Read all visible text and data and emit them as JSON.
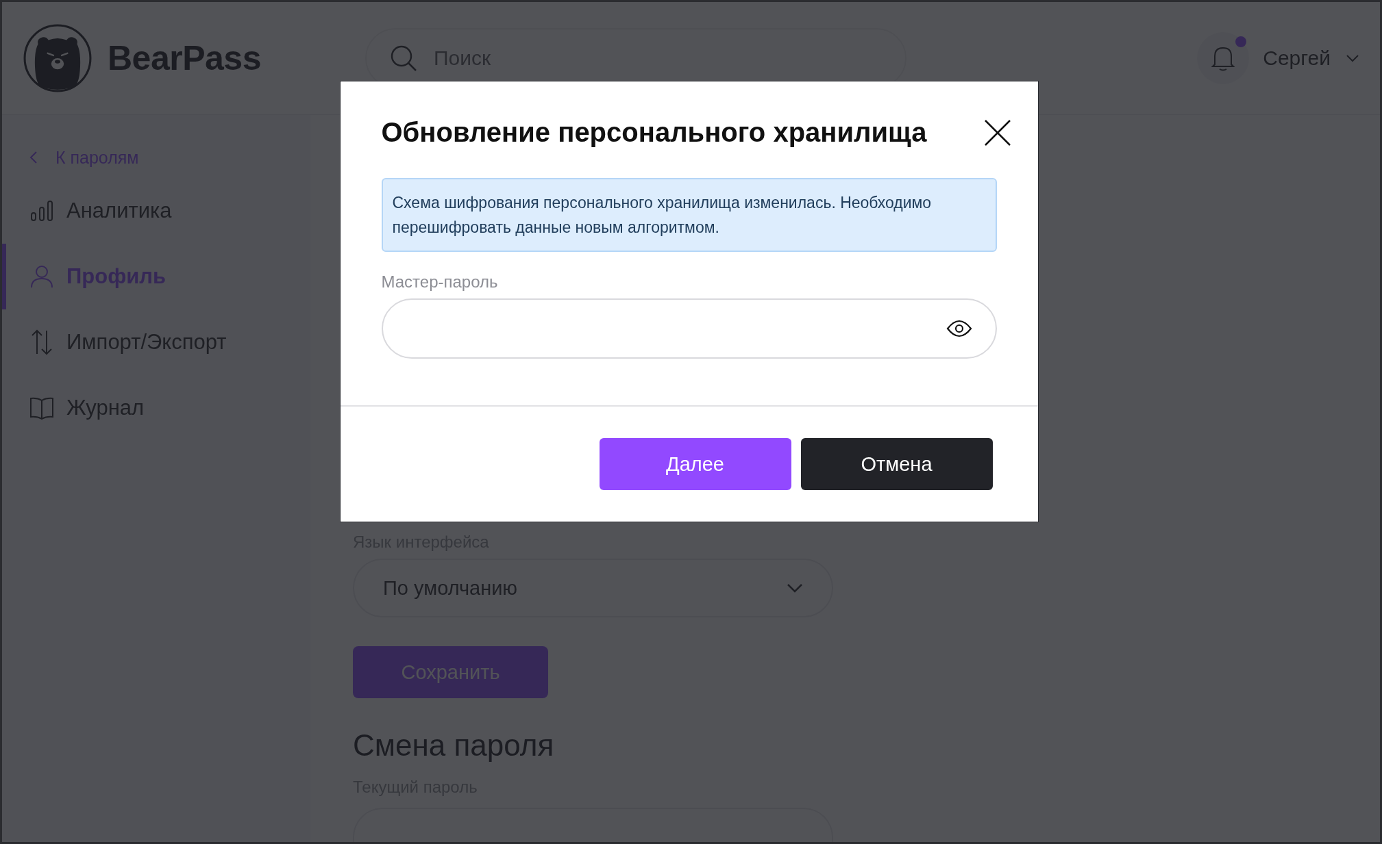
{
  "header": {
    "logo_text": "BearPass",
    "search": {
      "placeholder": "Поиск"
    },
    "notifications": {
      "unread": true
    },
    "user": {
      "name": "Сергей"
    }
  },
  "sidebar": {
    "back_link": "К паролям",
    "items": [
      {
        "kind": "chart",
        "label": "Аналитика",
        "selected": false
      },
      {
        "kind": "user",
        "label": "Профиль",
        "selected": true
      },
      {
        "kind": "arrows",
        "label": "Импорт/Экспорт",
        "selected": false
      },
      {
        "kind": "book",
        "label": "Журнал",
        "selected": false
      }
    ]
  },
  "content": {
    "language_label": "Язык интерфейса",
    "language_value": "По умолчанию",
    "save_button": "Сохранить",
    "password_heading": "Смена пароля",
    "current_password_label": "Текущий пароль"
  },
  "dialog": {
    "title": "Обновление персонального хранилища",
    "notice": "Схема шифрования персонального хранилища изменилась. Необходимо перешифровать данные новым алгоритмом.",
    "field_label": "Мастер-пароль",
    "buttons": [
      {
        "kind": "primary",
        "label": "Далее"
      },
      {
        "kind": "dark",
        "label": "Отмена"
      }
    ]
  }
}
